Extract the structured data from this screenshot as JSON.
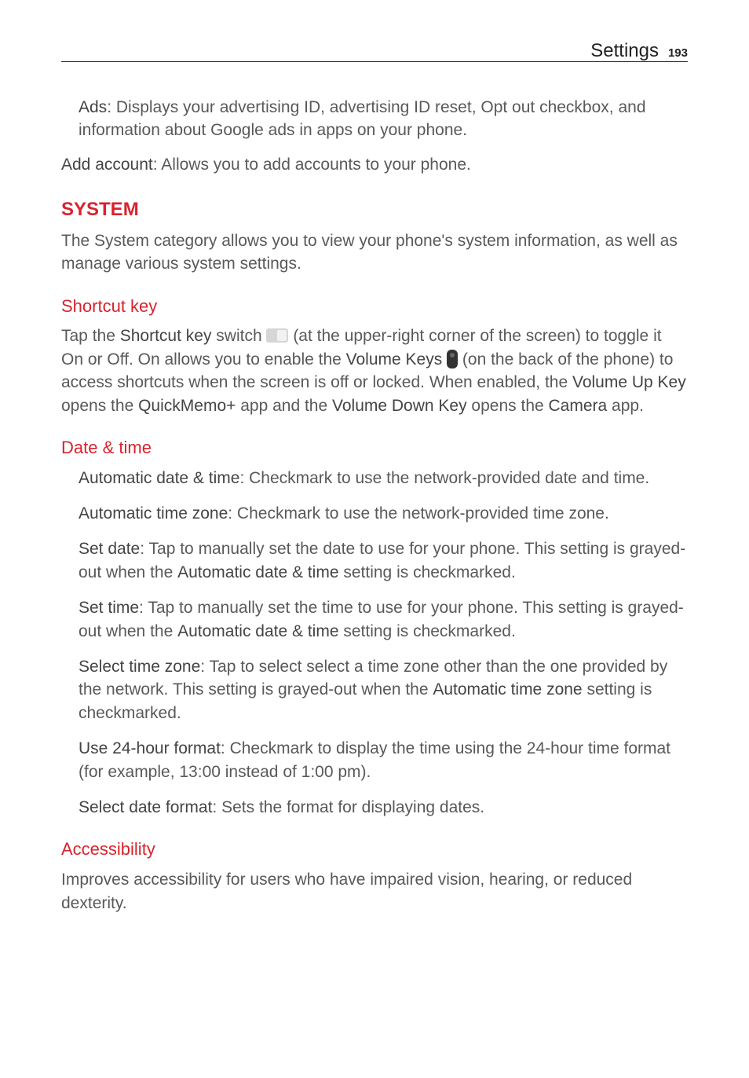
{
  "header": {
    "section": "Settings",
    "page_number": "193"
  },
  "intro": {
    "ads_bold": "Ads",
    "ads_text": ": Displays your advertising ID, advertising ID reset, Opt out checkbox, and information about Google ads in apps on your phone.",
    "add_account_bold": "Add account",
    "add_account_text": ": Allows you to add accounts to your phone."
  },
  "system": {
    "title": "SYSTEM",
    "desc": "The System category allows you to view your phone's system information, as well as manage various system settings."
  },
  "shortcut": {
    "title": "Shortcut key",
    "p1_a": "Tap the ",
    "p1_b": "Shortcut key",
    "p1_c": " switch ",
    "p1_d": " (at the upper-right corner of the screen) to toggle it On or Off. On allows you to enable the ",
    "p1_e": "Volume Keys",
    "p1_f": " ",
    "p1_g": " (on the back of the phone) to access shortcuts when the screen is off or locked. When enabled, the ",
    "p1_h": "Volume Up Key",
    "p1_i": " opens the ",
    "p1_j": "QuickMemo+",
    "p1_k": " app and the ",
    "p1_l": "Volume Down Key",
    "p1_m": " opens the ",
    "p1_n": "Camera",
    "p1_o": " app."
  },
  "datetime": {
    "title": "Date & time",
    "auto_dt_bold": "Automatic date & time",
    "auto_dt_text": ": Checkmark to use the network-provided date and time.",
    "auto_tz_bold": "Automatic time zone",
    "auto_tz_text": ": Checkmark to use the network-provided time zone.",
    "set_date_bold": "Set date",
    "set_date_text_a": ": Tap to manually set the date to use for your phone. This setting is grayed-out when the ",
    "set_date_text_b": "Automatic date & time",
    "set_date_text_c": " setting is checkmarked.",
    "set_time_bold": "Set time",
    "set_time_text_a": ": Tap to manually set the time to use for your phone. This setting is grayed-out when the ",
    "set_time_text_b": "Automatic date & time",
    "set_time_text_c": " setting is checkmarked.",
    "sel_tz_bold": "Select time zone",
    "sel_tz_text_a": ": Tap to select select a time zone other than the one provided by the network. This setting is grayed-out when the ",
    "sel_tz_text_b": "Automatic time zone",
    "sel_tz_text_c": " setting is checkmarked.",
    "u24_bold": "Use 24-hour format",
    "u24_text": ": Checkmark to display the time using the 24-hour time format (for example, 13:00 instead of 1:00 pm).",
    "sel_df_bold": "Select date format",
    "sel_df_text": ": Sets the format for displaying dates."
  },
  "accessibility": {
    "title": "Accessibility",
    "desc": "Improves accessibility for users who have impaired vision, hearing, or reduced dexterity."
  }
}
